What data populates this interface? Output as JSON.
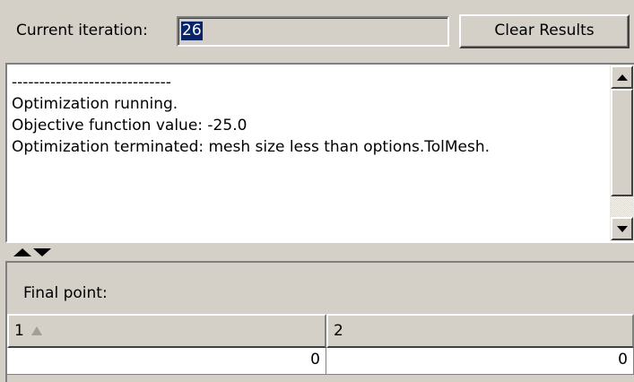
{
  "header": {
    "iteration_label": "Current iteration:",
    "iteration_value": "26",
    "clear_button_label": "Clear Results"
  },
  "log": {
    "lines": [
      "-----------------------------",
      "Optimization running.",
      "Objective function value: -25.0",
      "Optimization terminated: mesh size less than options.TolMesh."
    ]
  },
  "final_point": {
    "label": "Final point:",
    "columns": [
      "1",
      "2"
    ],
    "sorted_column_icon": "sort-ascending-icon",
    "rows": [
      [
        "0",
        "0"
      ]
    ]
  },
  "colors": {
    "panel_bg": "#d4d0c8",
    "selection_bg": "#0a246a",
    "selection_fg": "#ffffff",
    "text_area_bg": "#ffffff"
  }
}
